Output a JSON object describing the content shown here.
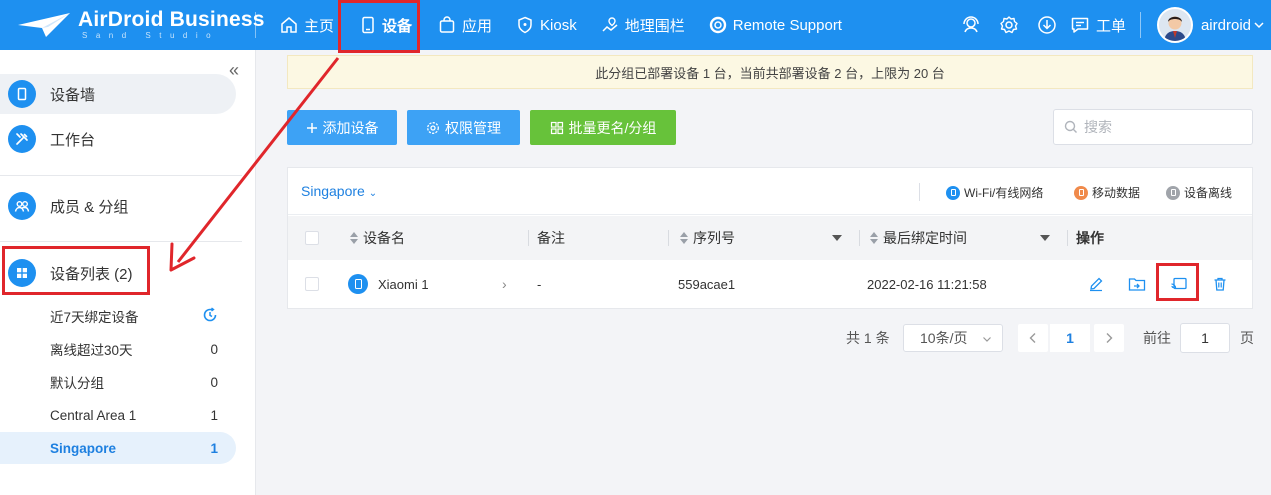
{
  "brand": {
    "title": "AirDroid Business",
    "subtitle": "Sand Studio"
  },
  "nav": [
    {
      "label": "主页",
      "icon": "home-icon"
    },
    {
      "label": "设备",
      "icon": "device-icon",
      "active": true
    },
    {
      "label": "应用",
      "icon": "app-bag-icon"
    },
    {
      "label": "Kiosk",
      "icon": "kiosk-shield-icon"
    },
    {
      "label": "地理围栏",
      "icon": "geofence-icon"
    },
    {
      "label": "Remote Support",
      "icon": "lifebuoy-icon"
    }
  ],
  "toolbar_right": {
    "ticket_label": "工单",
    "username": "airdroid"
  },
  "sidebar": {
    "items": [
      {
        "label": "设备墙",
        "icon": "device-wall-icon"
      },
      {
        "label": "工作台",
        "icon": "tools-icon"
      },
      {
        "label": "成员 & 分组",
        "icon": "members-icon"
      },
      {
        "label": "设备列表 (2)",
        "icon": "grid-icon"
      }
    ],
    "groups": [
      {
        "label": "近7天绑定设备",
        "count": ""
      },
      {
        "label": "离线超过30天",
        "count": "0"
      },
      {
        "label": "默认分组",
        "count": "0"
      },
      {
        "label": "Central Area 1",
        "count": "1"
      },
      {
        "label": "Singapore",
        "count": "1",
        "selected": true
      }
    ]
  },
  "notice": "此分组已部署设备 1 台，当前共部署设备 2 台，上限为 20 台",
  "actions": {
    "add_device": "添加设备",
    "permissions": "权限管理",
    "batch_rename": "批量更名/分组",
    "search_placeholder": "搜索"
  },
  "table": {
    "group_name": "Singapore",
    "legend": [
      {
        "label": "Wi-Fi/有线网络",
        "color": "#1e90f0"
      },
      {
        "label": "移动数据",
        "color": "#f08a4b"
      },
      {
        "label": "设备离线",
        "color": "#a0a4aa"
      }
    ],
    "columns": [
      "设备名",
      "备注",
      "序列号",
      "最后绑定时间",
      "操作"
    ],
    "rows": [
      {
        "name": "Xiaomi 1",
        "note": "-",
        "serial": "559acae1",
        "bound_time": "2022-02-16 11:21:58"
      }
    ]
  },
  "pagination": {
    "total_text": "共 1 条",
    "page_size": "10条/页",
    "current_page": "1",
    "goto_label": "前往",
    "goto_value": "1",
    "page_suffix": "页"
  },
  "colors": {
    "brand_blue": "#1e90f0",
    "green": "#67c23a",
    "annotation_red": "#e0262b"
  }
}
